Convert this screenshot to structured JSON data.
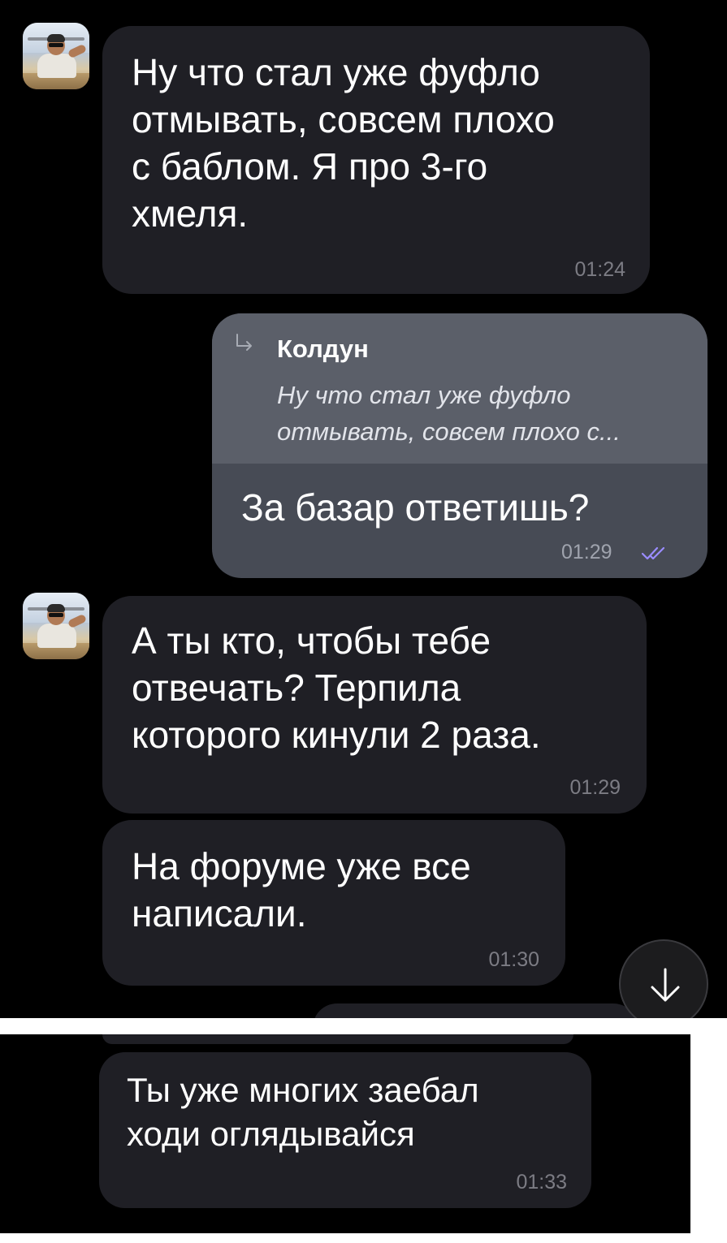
{
  "messages": [
    {
      "id": "m1",
      "text": "Ну что стал уже фуфло\nотмывать, совсем плохо\nс баблом. Я про 3-го\nхмеля.",
      "time": "01:24"
    },
    {
      "id": "m2",
      "reply_author": "Колдун",
      "reply_text": "Ну что стал уже фуфло\nотмывать, совсем плохо с...",
      "text": "За базар ответишь?",
      "time": "01:29",
      "status": "read"
    },
    {
      "id": "m3",
      "text": "А ты кто, чтобы тебе\nотвечать? Терпила\nкоторого кинули 2 раза.",
      "time": "01:29"
    },
    {
      "id": "m4",
      "text": "На форуме уже все\nнаписали.",
      "time": "01:30"
    },
    {
      "id": "m5",
      "text": "Ты уже многих заебал\nходи оглядывайся",
      "time": "01:33"
    }
  ],
  "icons": {
    "avatar": "user-avatar",
    "reply": "reply-arrow-icon",
    "status": "double-check-icon",
    "scroll": "arrow-down-icon"
  },
  "colors": {
    "background": "#000000",
    "incoming_bubble": "#1f1f25",
    "outgoing_bubble": "#474b55",
    "reply_block": "#5b5f69",
    "read_check": "#9a8cff",
    "timestamp": "#7c7c84"
  }
}
